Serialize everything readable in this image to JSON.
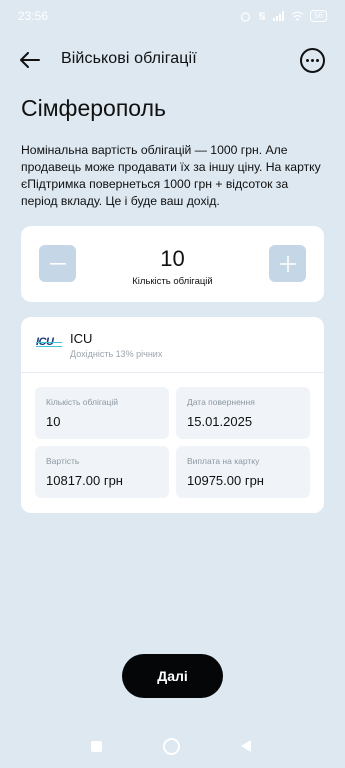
{
  "status_bar": {
    "time": "23:56",
    "battery": "56"
  },
  "header": {
    "title": "Військові облігації"
  },
  "page_title": "Сімферополь",
  "description": "Номінальна вартість облігацій — 1000 грн. Але продавець може продавати їх за іншу ціну. На картку єПідтримка повернеться 1000 грн + відсоток за період вкладу. Це і буде ваш дохід.",
  "stepper": {
    "value": "10",
    "label": "Кількість облігацій",
    "minus": "−",
    "plus": "+"
  },
  "bond": {
    "logo": "ICU",
    "name": "ICU",
    "yield": "Дохідність 13% річних",
    "tiles": [
      {
        "label": "Кількість облігацій",
        "value": "10"
      },
      {
        "label": "Дата повернення",
        "value": "15.01.2025"
      },
      {
        "label": "Вартість",
        "value": "10817.00 грн"
      },
      {
        "label": "Виплата на картку",
        "value": "10975.00 грн"
      }
    ]
  },
  "next_button": {
    "label": "Далі"
  },
  "icons": {
    "back": "arrow-left-icon",
    "more": "more-horizontal-icon",
    "minus": "minus-icon",
    "plus": "plus-icon"
  },
  "colors": {
    "background": "#dde8f1",
    "card": "#ffffff",
    "stepper_button": "#c5d7e6",
    "primary_button": "#050608",
    "tile": "#f0f4f8"
  }
}
